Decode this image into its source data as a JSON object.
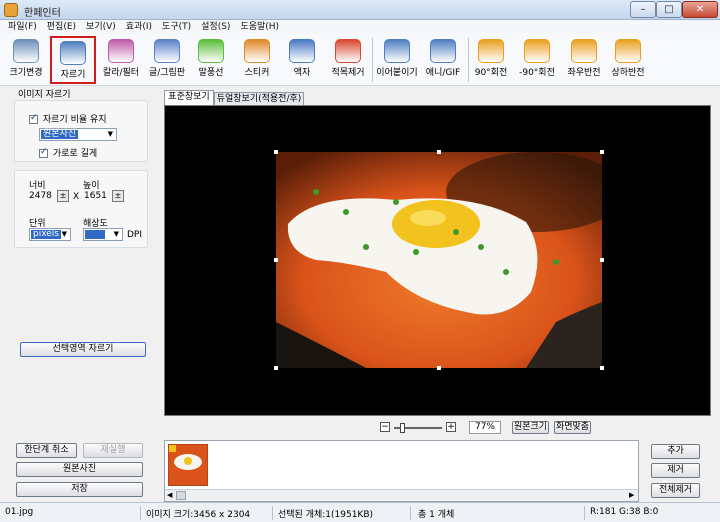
{
  "window": {
    "title": "한페인터",
    "controls": {
      "minimize": "–",
      "maximize": "□",
      "close": "✕"
    }
  },
  "menu": [
    "파일(F)",
    "편집(E)",
    "보기(V)",
    "효과(I)",
    "도구(T)",
    "설정(S)",
    "도움말(H)"
  ],
  "toolbar": [
    {
      "label": "크기변경",
      "icon": "resize-icon",
      "color": "#6d8fb8"
    },
    {
      "label": "자르기",
      "icon": "crop-icon",
      "color": "#4f7fc2",
      "selected": true
    },
    {
      "label": "칼라/필터",
      "icon": "color-filter-icon",
      "color": "#c05aa8"
    },
    {
      "label": "글/그림판",
      "icon": "text-board-icon",
      "color": "#5b82c9"
    },
    {
      "label": "말풍선",
      "icon": "speech-bubble-icon",
      "color": "#5cbf3c"
    },
    {
      "label": "스티커",
      "icon": "sticker-icon",
      "color": "#e08a2a"
    },
    {
      "label": "액자",
      "icon": "frame-icon",
      "color": "#4a79c4"
    },
    {
      "label": "적목제거",
      "icon": "red-eye-icon",
      "color": "#d9482f"
    },
    {
      "label": "이어붙이기",
      "icon": "merge-icon",
      "color": "#4f7fc2"
    },
    {
      "label": "애니/GIF",
      "icon": "gif-icon",
      "color": "#4f7fc2"
    },
    {
      "label": "90°회전",
      "icon": "rotate-cw-icon",
      "color": "#e9a020"
    },
    {
      "label": "-90°회전",
      "icon": "rotate-ccw-icon",
      "color": "#e9a020"
    },
    {
      "label": "좌우반전",
      "icon": "flip-horizontal-icon",
      "color": "#e9a020"
    },
    {
      "label": "상하반전",
      "icon": "flip-vertical-icon",
      "color": "#e9a020"
    }
  ],
  "crop_panel": {
    "title": "이미지 자르기",
    "keep_ratio_label": "자르기 비율 유지",
    "ratio_value": "원본사진",
    "landscape_label": "가로로 길게",
    "width_label": "너비",
    "height_label": "높이",
    "width_value": "2478",
    "height_value": "1651",
    "x_label": "X",
    "unit_label": "단위",
    "unit_value": "pixels",
    "resolution_label": "해상도",
    "resolution_unit": "DPI",
    "apply_button": "선택영역 자르기"
  },
  "left_buttons": {
    "undo": "한단계 취소",
    "redo": "재실행",
    "original": "원본사진",
    "save": "저장"
  },
  "tabs": [
    "표준창보기",
    "듀얼창보기(적용전/후)"
  ],
  "zoom": {
    "minus": "−",
    "plus": "+",
    "value": "77%",
    "level": 0.15,
    "actual_size": "원본크기",
    "fit_screen": "화면맞춤"
  },
  "right_buttons": {
    "add": "추가",
    "remove": "제거",
    "remove_all": "전체제거"
  },
  "status": {
    "filename": "01.jpg",
    "image_size": "이미지 크기:3456 x 2304",
    "selected": "선택된 개체:1(1951KB)",
    "total": "총 1 개체",
    "pixel_color": "R:181 G:38 B:0"
  },
  "colors": {
    "accent": "#316ac5",
    "selected_border": "#d21b1b",
    "canvas_bg": "#000000"
  }
}
